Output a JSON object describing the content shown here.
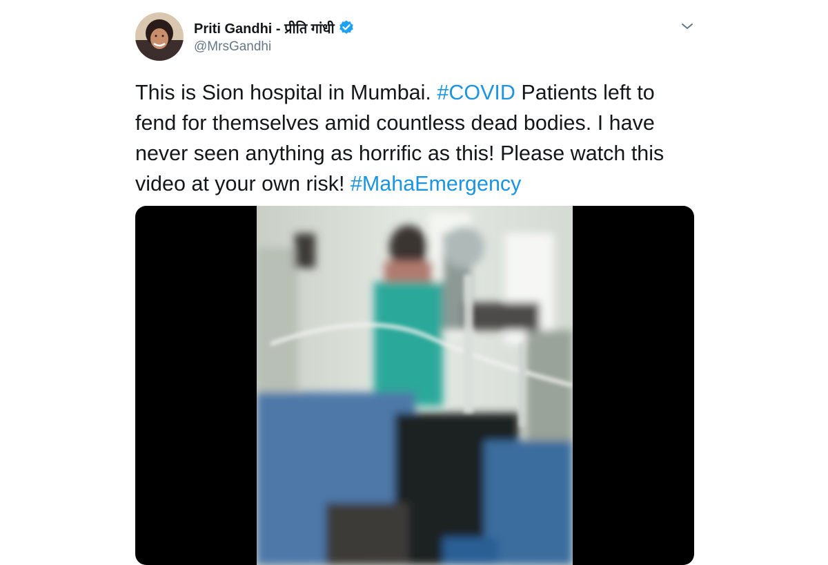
{
  "tweet": {
    "author": {
      "display_name": "Priti Gandhi - प्रीति गांधी",
      "handle": "@MrsGandhi",
      "verified_icon": "verified-badge-icon",
      "avatar": "profile-photo"
    },
    "menu_icon": "chevron-down-icon",
    "text": {
      "part1": "This is Sion hospital in Mumbai. ",
      "hashtag1": "#COVID",
      "part2": " Patients left to fend for themselves amid countless dead bodies. I have never seen anything as horrific as this! Please watch this video at your own risk! ",
      "hashtag2": "#MahaEmergency"
    },
    "media": {
      "type": "video"
    }
  },
  "colors": {
    "text": "#14171a",
    "secondary_text": "#657786",
    "hashtag": "#1b95e0",
    "verified": "#1da1f2",
    "media_background": "#000000"
  }
}
